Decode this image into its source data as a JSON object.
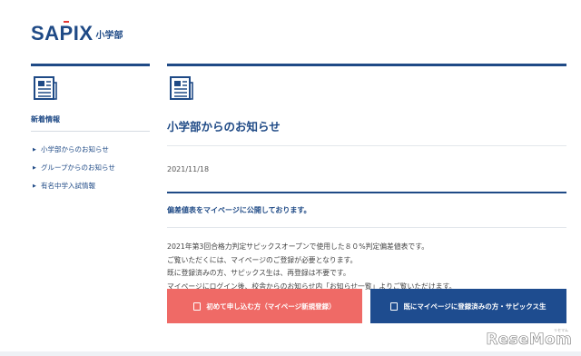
{
  "logo": {
    "main": "SAPIX",
    "sub": "小学部"
  },
  "sidebar": {
    "title": "新着情報",
    "items": [
      {
        "label": "小学部からのお知らせ"
      },
      {
        "label": "グループからのお知らせ"
      },
      {
        "label": "有名中学入試情報"
      }
    ]
  },
  "main": {
    "title": "小学部からのお知らせ",
    "date": "2021/11/18",
    "notice": "偏差値表をマイページに公開しております。",
    "body": [
      "2021年第3回合格力判定サピックスオープンで使用した８０%判定偏差値表です。",
      "ご覧いただくには、マイページのご登録が必要となります。",
      "既に登録済みの方、サピックス生は、再登録は不要です。",
      "マイページにログイン後、校舎からのお知らせ内「お知らせ一覧」よりご覧いただけます。"
    ]
  },
  "buttons": {
    "first": "初めて申し込む方（マイページ新規登録）",
    "registered": "既にマイページに登録済みの方・サピックス生"
  },
  "watermark": {
    "text": "ReseMom",
    "kana": "リセマム"
  },
  "colors": {
    "brand": "#1f4a86",
    "red_button": "#ef6a66",
    "blue_button": "#1e4c8f"
  }
}
